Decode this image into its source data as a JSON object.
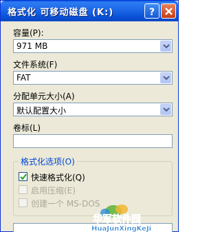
{
  "window": {
    "title": "格式化 可移动磁盘 (K:)"
  },
  "titlebar_buttons": {
    "help": "?",
    "close": "close"
  },
  "capacity": {
    "label": "容量(P):",
    "value": "971 MB"
  },
  "filesystem": {
    "label": "文件系统(F)",
    "value": "FAT"
  },
  "allocation": {
    "label": "分配单元大小(A)",
    "value": "默认配置大小"
  },
  "volume_label": {
    "label": "卷标(L)",
    "value": ""
  },
  "format_options": {
    "title": "格式化选项(O)",
    "quick_format": {
      "label": "快速格式化(Q)",
      "checked": true,
      "enabled": true
    },
    "compression": {
      "label": "启用压缩(E)",
      "checked": false,
      "enabled": false
    },
    "msdos": {
      "label": "创建一个 MS-DOS",
      "checked": false,
      "enabled": false
    }
  },
  "watermark": {
    "text": "华军软件园",
    "subtext": "HuaJunXingKeJi"
  },
  "colors": {
    "title_bar": "#0b54d8",
    "dialog_bg": "#ece9d8",
    "group_title": "#0046d5",
    "close_button": "#c43c16"
  }
}
